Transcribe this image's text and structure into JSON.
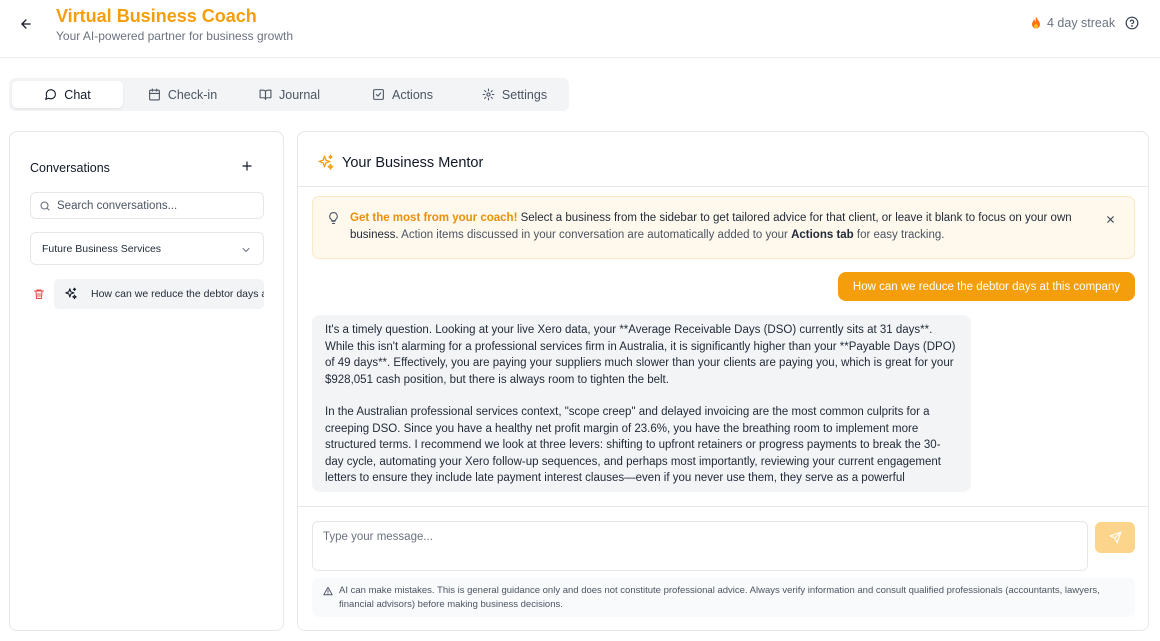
{
  "header": {
    "title": "Virtual Business Coach",
    "subtitle": "Your AI-powered partner for business growth",
    "streak": "4 day streak"
  },
  "tabs": [
    {
      "label": "Chat",
      "icon": "message-circle-icon",
      "active": true
    },
    {
      "label": "Check-in",
      "icon": "calendar-icon",
      "active": false
    },
    {
      "label": "Journal",
      "icon": "book-open-icon",
      "active": false
    },
    {
      "label": "Actions",
      "icon": "check-square-icon",
      "active": false
    },
    {
      "label": "Settings",
      "icon": "gear-icon",
      "active": false
    }
  ],
  "sidebar": {
    "title": "Conversations",
    "search_placeholder": "Search conversations...",
    "business_select": "Future Business Services",
    "conversations": [
      {
        "label": "How can we reduce the debtor days at this company"
      }
    ]
  },
  "main": {
    "title": "Your Business Mentor",
    "tip": {
      "highlight": "Get the most from your coach!",
      "text_main": " Select a business from the sidebar to get tailored advice for that client, or leave it blank to focus on your own business.",
      "text_secondary": " Action items discussed in your conversation are automatically added to your ",
      "text_bold": "Actions tab",
      "text_end": " for easy tracking."
    },
    "messages": [
      {
        "role": "user",
        "text": "How can we reduce the debtor days at this company"
      },
      {
        "role": "assistant",
        "paragraphs": [
          "It's a timely question. Looking at your live Xero data, your **Average Receivable Days (DSO) currently sits at 31 days**. While this isn't alarming for a professional services firm in Australia, it is significantly higher than your **Payable Days (DPO) of 49 days**. Effectively, you are paying your suppliers much slower than your clients are paying you, which is great for your $928,051 cash position, but there is always room to tighten the belt.",
          "In the Australian professional services context, \"scope creep\" and delayed invoicing are the most common culprits for a creeping DSO. Since you have a healthy net profit margin of 23.6%, you have the breathing room to implement more structured terms. I recommend we look at three levers: shifting to upfront retainers or progress payments to break the 30-day cycle, automating your Xero follow-up sequences, and perhaps most importantly, reviewing your current engagement letters to ensure they include late payment interest clauses—even if you never use them, they serve as a powerful"
        ]
      }
    ],
    "input_placeholder": "Type your message...",
    "disclaimer": "AI can make mistakes. This is general guidance only and does not constitute professional advice. Always verify information and consult qualified professionals (accountants, lawyers, financial advisors) before making business decisions."
  },
  "colors": {
    "accent": "#f59e0b",
    "accent_light": "#fcd48b",
    "tip_bg": "#fff8ec",
    "streak_flame": "#f97316",
    "trash": "#ef4444"
  }
}
